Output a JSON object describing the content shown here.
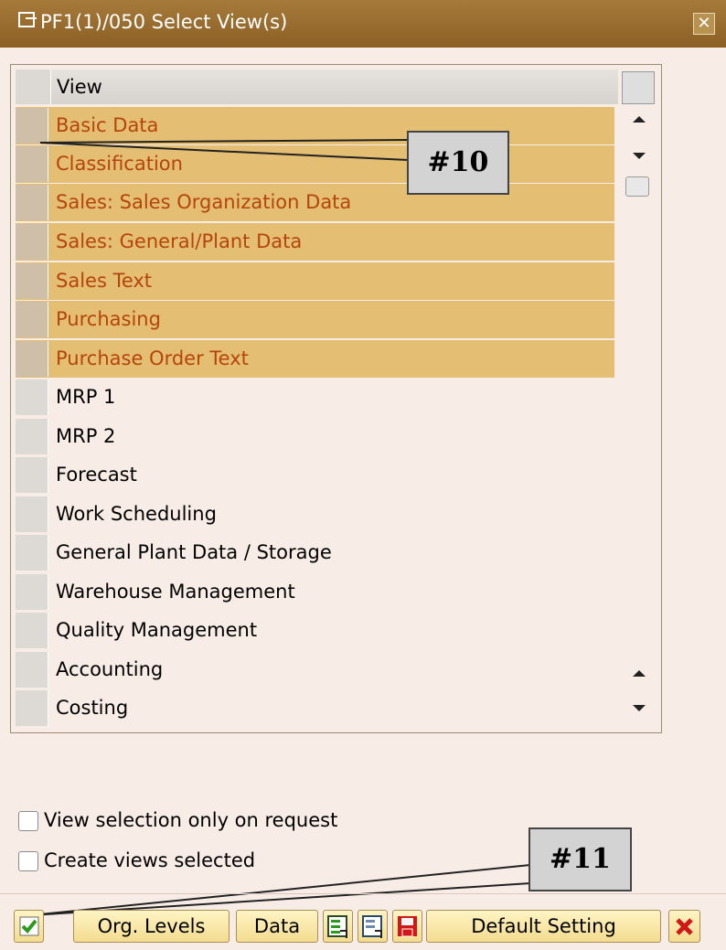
{
  "window": {
    "title": "PF1(1)/050 Select View(s)",
    "close_symbol": "✕"
  },
  "table": {
    "header": "View",
    "rows": [
      {
        "label": "Basic Data",
        "selected": true
      },
      {
        "label": "Classification",
        "selected": true
      },
      {
        "label": "Sales: Sales Organization Data",
        "selected": true
      },
      {
        "label": "Sales: General/Plant Data",
        "selected": true
      },
      {
        "label": "Sales Text",
        "selected": true
      },
      {
        "label": "Purchasing",
        "selected": true
      },
      {
        "label": "Purchase Order Text",
        "selected": true
      },
      {
        "label": "MRP 1",
        "selected": false
      },
      {
        "label": "MRP 2",
        "selected": false
      },
      {
        "label": "Forecast",
        "selected": false
      },
      {
        "label": "Work Scheduling",
        "selected": false
      },
      {
        "label": "General Plant Data / Storage",
        "selected": false
      },
      {
        "label": "Warehouse Management",
        "selected": false
      },
      {
        "label": "Quality Management",
        "selected": false
      },
      {
        "label": "Accounting",
        "selected": false
      },
      {
        "label": "Costing",
        "selected": false
      }
    ]
  },
  "callouts": {
    "a": "#10",
    "b": "#11"
  },
  "options": {
    "view_selection_only_on_request": {
      "label": "View selection only on request",
      "checked": false
    },
    "create_views_selected": {
      "label": "Create views selected",
      "checked": false
    }
  },
  "toolbar": {
    "org_levels": "Org. Levels",
    "data": "Data",
    "default_setting": "Default Setting",
    "icons": [
      "checkmark-icon",
      "select-all-icon",
      "deselect-all-icon",
      "save-icon",
      "cancel-icon"
    ]
  },
  "colors": {
    "title_bar": "#9a6e30",
    "selected_row_bg": "#e3be73",
    "selected_row_text": "#b5450c",
    "background": "#f7ece6",
    "button_bg": "#f7e3a0",
    "check_green": "#2c9a1c",
    "cancel_red": "#d01818"
  }
}
